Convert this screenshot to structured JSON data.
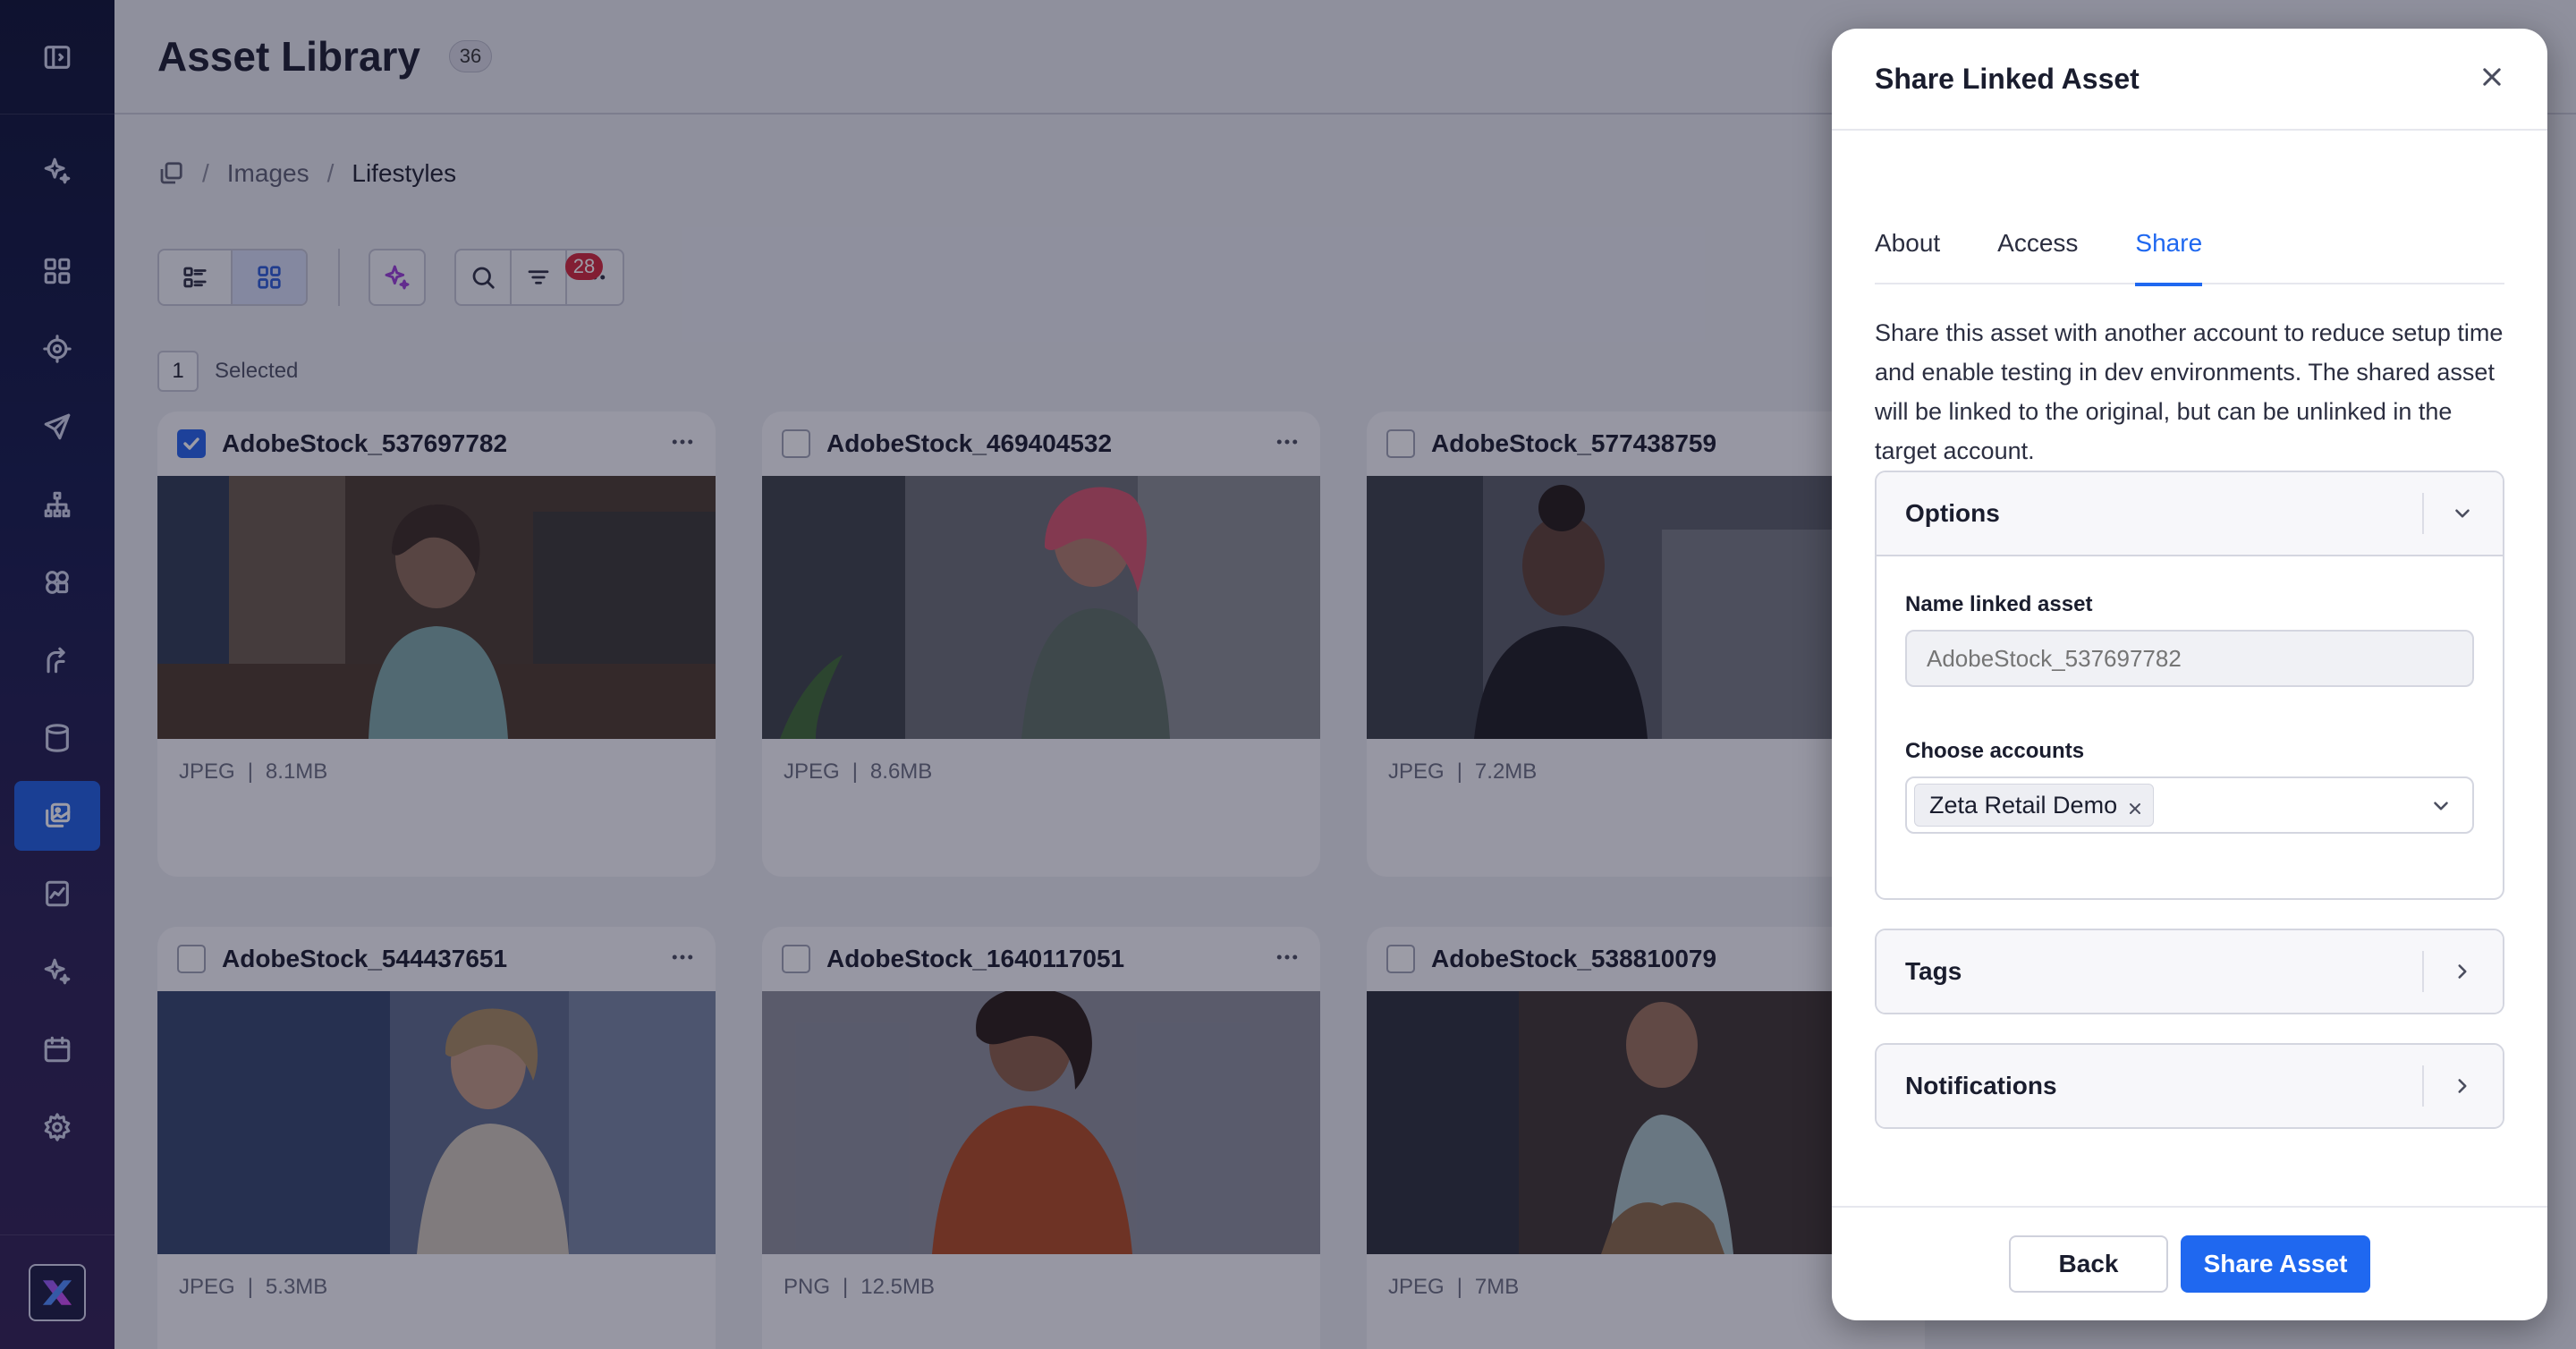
{
  "app": {
    "title": "Asset Library",
    "asset_count": "36"
  },
  "breadcrumb": {
    "items": [
      "Images",
      "Lifestyles"
    ],
    "separator": "/"
  },
  "toolbar": {
    "filter_count": "28"
  },
  "selection": {
    "count": "1",
    "label": "Selected"
  },
  "assets": [
    {
      "name": "AdobeStock_537697782",
      "type": "JPEG",
      "size": "8.1MB",
      "checked": true
    },
    {
      "name": "AdobeStock_469404532",
      "type": "JPEG",
      "size": "8.6MB",
      "checked": false
    },
    {
      "name": "AdobeStock_577438759",
      "type": "JPEG",
      "size": "7.2MB",
      "checked": false
    },
    {
      "name": "AdobeStock_544437651",
      "type": "JPEG",
      "size": "5.3MB",
      "checked": false
    },
    {
      "name": "AdobeStock_1640117051",
      "type": "PNG",
      "size": "12.5MB",
      "checked": false
    },
    {
      "name": "AdobeStock_538810079",
      "type": "JPEG",
      "size": "7MB",
      "checked": false
    }
  ],
  "modal": {
    "title": "Share Linked Asset",
    "tabs": [
      {
        "label": "About",
        "active": false
      },
      {
        "label": "Access",
        "active": false
      },
      {
        "label": "Share",
        "active": true
      }
    ],
    "description": "Share this asset with another account to reduce setup time and enable testing in dev environments. The shared asset will be linked to the original, but can be unlinked in the target account.",
    "options": {
      "title": "Options",
      "name_label": "Name linked asset",
      "name_placeholder": "AdobeStock_537697782",
      "accounts_label": "Choose accounts",
      "selected_account": "Zeta Retail Demo"
    },
    "tags_title": "Tags",
    "notifications_title": "Notifications",
    "back_label": "Back",
    "share_label": "Share Asset"
  },
  "colors": {
    "accent": "#1f68f0",
    "sidebar_active": "#1f5fe0",
    "badge": "#d3273a"
  }
}
